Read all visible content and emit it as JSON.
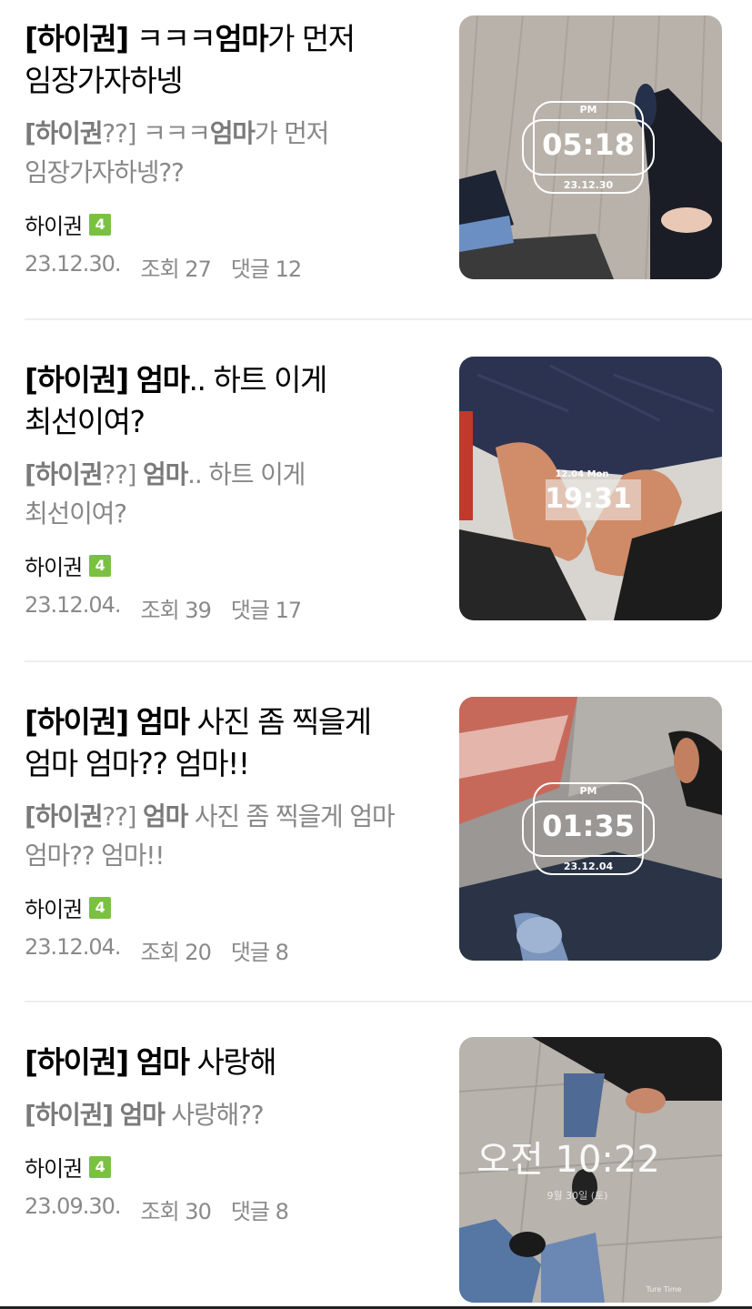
{
  "posts": [
    {
      "title_tag": "[하이권]",
      "title_pre": " ㅋㅋㅋ",
      "title_bold": "엄마",
      "title_post": "가 먼저",
      "title_line2": "임장가자하넹",
      "snippet_tag": "[하이권",
      "snippet_q": "??]",
      "snippet_pre": " ㅋㅋㅋ",
      "snippet_bold": "엄마",
      "snippet_post": "가 먼저",
      "snippet_line2": "임장가자하넹??",
      "author": "하이권",
      "badge": "4",
      "date": "23.12.30.",
      "views": "조회 27",
      "comments": "댓글 12",
      "thumb": {
        "ampm": "PM",
        "time": "05:18",
        "date": "23.12.30"
      }
    },
    {
      "title_tag": "[하이권]",
      "title_bold": "엄마",
      "title_post": ".. 하트 이게",
      "title_line2": "최선이여?",
      "snippet_tag": "[하이권",
      "snippet_q": "??]",
      "snippet_bold": "엄마",
      "snippet_post": ".. 하트 이게",
      "snippet_line2": "최선이여?",
      "author": "하이권",
      "badge": "4",
      "date": "23.12.04.",
      "views": "조회 39",
      "comments": "댓글 17",
      "thumb": {
        "small": "12.04 Mon",
        "time": "19:31"
      }
    },
    {
      "title_tag": "[하이권]",
      "title_bold": "엄마",
      "title_post": " 사진 좀 찍을게",
      "title_line2": "엄마 엄마?? 엄마!!",
      "snippet_tag": "[하이권",
      "snippet_q": "??]",
      "snippet_bold": "엄마",
      "snippet_post": " 사진 좀 찍을게 엄마",
      "snippet_line2": "엄마?? 엄마!!",
      "author": "하이권",
      "badge": "4",
      "date": "23.12.04.",
      "views": "조회 20",
      "comments": "댓글 8",
      "thumb": {
        "ampm": "PM",
        "time": "01:35",
        "date": "23.12.04"
      }
    },
    {
      "title_tag": "[하이권]",
      "title_bold": "엄마",
      "title_post": " 사랑해",
      "snippet_tag": "[하이권]",
      "snippet_bold": "엄마",
      "snippet_post": " 사랑해??",
      "author": "하이권",
      "badge": "4",
      "date": "23.09.30.",
      "views": "조회 30",
      "comments": "댓글 8",
      "thumb": {
        "time": "오전 10:22",
        "small": "9월 30일 (토)",
        "brand": "Ture Time"
      }
    }
  ],
  "colors": {
    "badge": "#7ac142",
    "meta": "#8a8a8a",
    "snippet": "#888888"
  }
}
